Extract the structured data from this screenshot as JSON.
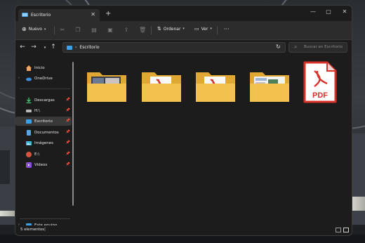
{
  "window": {
    "tab_title": "Escritorio"
  },
  "toolbar": {
    "new_label": "Nuevo",
    "sort_label": "Ordenar",
    "view_label": "Ver",
    "more": "···"
  },
  "address": {
    "crumb": "Escritorio",
    "search_placeholder": "Buscar en Escritorio"
  },
  "sidebar": {
    "items": [
      {
        "label": "Inicio",
        "icon": "home-icon"
      },
      {
        "label": "OneDrive",
        "icon": "onedrive-icon"
      },
      {
        "label": "Descargas",
        "icon": "download-icon"
      },
      {
        "label": "H:\\",
        "icon": "drive-icon"
      },
      {
        "label": "Escritorio",
        "icon": "desktop-icon"
      },
      {
        "label": "Documentos",
        "icon": "documents-icon"
      },
      {
        "label": "Imágenes",
        "icon": "pictures-icon"
      },
      {
        "label": "E:\\",
        "icon": "drive-icon"
      },
      {
        "label": "Videos",
        "icon": "videos-icon"
      },
      {
        "label": "Este equipo",
        "icon": "computer-icon"
      }
    ]
  },
  "status": {
    "count": "5 elementos"
  },
  "colors": {
    "folder": "#f3c14e",
    "folder_back": "#e0a832",
    "pdf_red": "#d8312a",
    "accent": "#4cc2ff"
  }
}
